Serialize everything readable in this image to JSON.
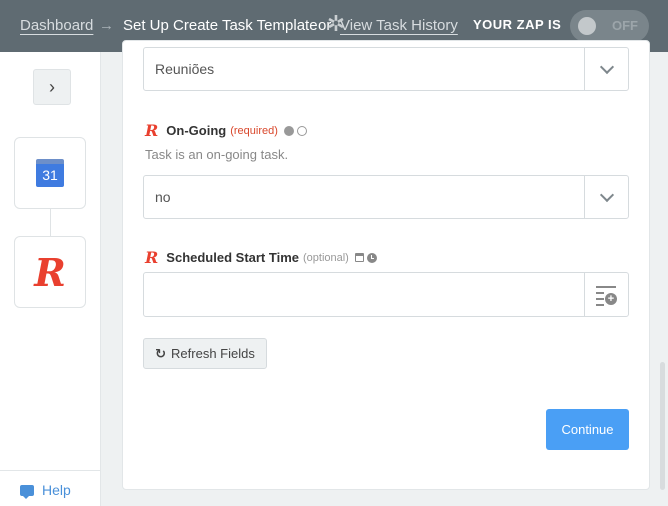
{
  "header": {
    "breadcrumb_dashboard": "Dashboard",
    "breadcrumb_arrow": "→",
    "breadcrumb_title": "Set Up Create Task Template",
    "breadcrumb_or": "or",
    "view_history": "View Task History",
    "zap_status_label": "YOUR ZAP IS",
    "zap_toggle_state": "OFF",
    "spinner_glyph": "✲"
  },
  "sidebar": {
    "expand_glyph": "›",
    "steps": [
      {
        "app": "Google Calendar",
        "icon": "google-calendar-icon",
        "calendar_day": "31"
      },
      {
        "app": "Rocketbots/R app",
        "icon": "r-app-icon",
        "glyph": "R"
      }
    ],
    "help_label": "Help"
  },
  "form": {
    "previous_select_value": "Reuniões",
    "ongoing": {
      "logo": "R",
      "label": "On-Going",
      "badge": "(required)",
      "help_text": "Task is an on-going task.",
      "value": "no"
    },
    "scheduled_start": {
      "logo": "R",
      "label": "Scheduled Start Time",
      "badge": "(optional)",
      "value": "",
      "placeholder": ""
    },
    "refresh_label": "Refresh Fields",
    "refresh_glyph": "↻",
    "insert_plus": "+",
    "continue_label": "Continue"
  },
  "colors": {
    "header_bg": "#5f6b72",
    "accent_blue": "#4a9ff5",
    "required_red": "#d9472b",
    "r_logo_red": "#e9402f"
  }
}
